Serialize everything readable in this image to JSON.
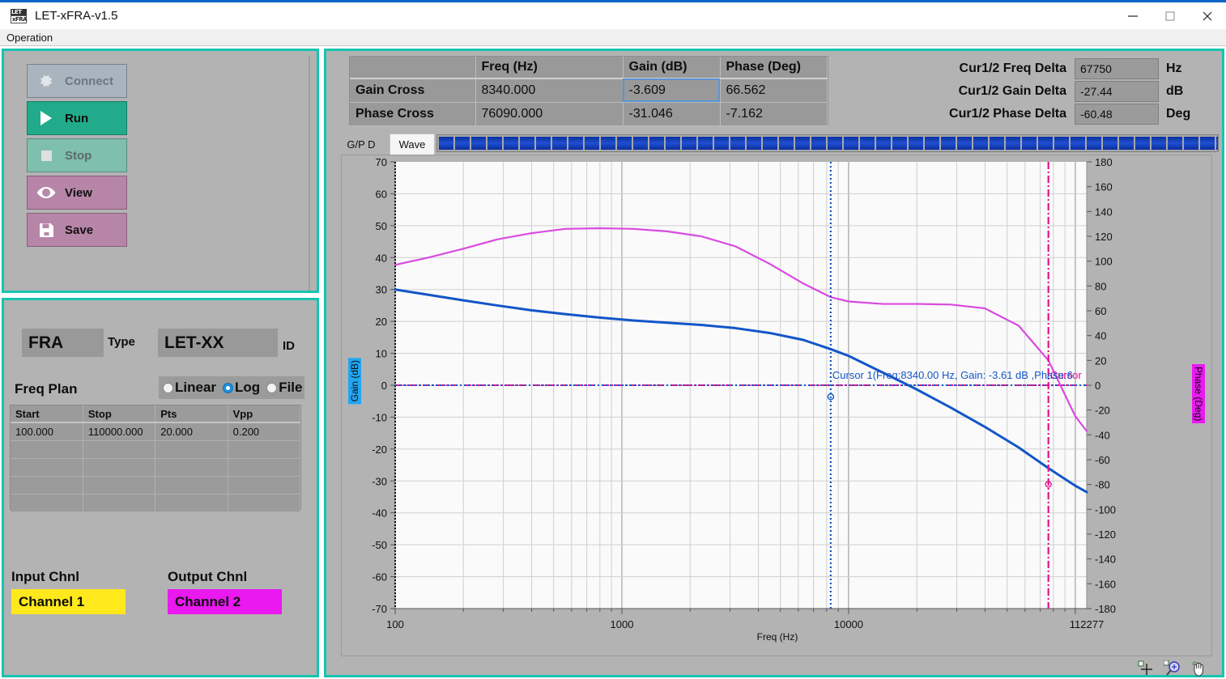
{
  "window": {
    "title": "LET-xFRA-v1.5",
    "icon": "app-icon",
    "minimize": "minimize-icon",
    "maximize": "maximize-icon",
    "close": "close-icon"
  },
  "menubar": {
    "items": [
      "Operation"
    ]
  },
  "operations": {
    "buttons": [
      {
        "label": "Connect",
        "icon": "gear-icon",
        "enabled": false,
        "color": "#aab4bf"
      },
      {
        "label": "Run",
        "icon": "play-icon",
        "enabled": true,
        "color": "#21ab8b"
      },
      {
        "label": "Stop",
        "icon": "stop-icon",
        "enabled": false,
        "color": "#7fbfae"
      },
      {
        "label": "View",
        "icon": "eye-icon",
        "enabled": true,
        "color": "#b785a8"
      },
      {
        "label": "Save",
        "icon": "save-icon",
        "enabled": true,
        "color": "#b785a8"
      }
    ]
  },
  "config": {
    "type_value": "FRA",
    "type_label": "Type",
    "id_value": "LET-XX",
    "id_label": "ID",
    "freq_plan_label": "Freq Plan",
    "sweep_modes": [
      {
        "label": "Linear",
        "selected": false
      },
      {
        "label": "Log",
        "selected": true
      },
      {
        "label": "File",
        "selected": false
      }
    ],
    "freq_table": {
      "columns": [
        "Start",
        "Stop",
        "Pts",
        "Vpp"
      ],
      "rows": [
        [
          "100.000",
          "110000.000",
          "20.000",
          "0.200"
        ],
        [
          "",
          "",
          "",
          ""
        ],
        [
          "",
          "",
          "",
          ""
        ],
        [
          "",
          "",
          "",
          ""
        ],
        [
          "",
          "",
          "",
          ""
        ]
      ]
    },
    "input_chnl_label": "Input Chnl",
    "input_chnl_value": "Channel 1",
    "input_chnl_color": "#ffe81c",
    "output_chnl_label": "Output Chnl",
    "output_chnl_value": "Channel 2",
    "output_chnl_color": "#e919ef"
  },
  "results": {
    "columns": [
      "",
      "Freq (Hz)",
      "Gain (dB)",
      "Phase (Deg)"
    ],
    "rows": [
      {
        "name": "Gain Cross",
        "freq": "8340.000",
        "gain": "-3.609",
        "phase": "66.562",
        "gain_selected": true
      },
      {
        "name": "Phase Cross",
        "freq": "76090.000",
        "gain": "-31.046",
        "phase": "-7.162",
        "gain_selected": false
      }
    ]
  },
  "cursor_deltas": [
    {
      "label": "Cur1/2 Freq Delta",
      "value": "67750",
      "unit": "Hz"
    },
    {
      "label": "Cur1/2 Gain Delta",
      "value": "-27.44",
      "unit": "dB"
    },
    {
      "label": "Cur1/2 Phase Delta",
      "value": "-60.48",
      "unit": "Deg"
    }
  ],
  "tabs": [
    {
      "label": "G/P D",
      "active": true
    },
    {
      "label": "Wave",
      "active": false
    }
  ],
  "progress": {
    "percent": 100,
    "segments": 49
  },
  "chart_tools": [
    "crosshair-icon",
    "zoom-icon",
    "pan-icon"
  ],
  "chart_data": {
    "type": "line",
    "title": "",
    "xlabel": "Freq (Hz)",
    "ylabel": "Gain (dB)",
    "y2label": "Phase (Deg)",
    "xscale": "log",
    "xlim": [
      100,
      112277
    ],
    "xticks": [
      100,
      1000,
      10000,
      112277
    ],
    "xticklabels": [
      "100",
      "1000",
      "10000",
      "112277"
    ],
    "ylim": [
      -70,
      70
    ],
    "yticks": [
      70,
      60,
      50,
      40,
      30,
      20,
      10,
      0,
      -10,
      -20,
      -30,
      -40,
      -50,
      -60,
      -70
    ],
    "y2lim": [
      -180,
      180
    ],
    "y2ticks": [
      180,
      160,
      140,
      120,
      100,
      80,
      60,
      40,
      20,
      0,
      -20,
      -40,
      -60,
      -80,
      -100,
      -120,
      -140,
      -160,
      -180
    ],
    "grid": true,
    "legend": "none",
    "series": [
      {
        "name": "Gain",
        "axis": "left",
        "color": "#1256c8",
        "x": [
          100,
          141,
          200,
          282,
          398,
          562,
          794,
          1122,
          1585,
          2239,
          3162,
          4467,
          6310,
          8340,
          10000,
          14125,
          19953,
          28184,
          39811,
          56234,
          76090,
          100000,
          112277
        ],
        "values": [
          30.0,
          28.3,
          26.6,
          25.0,
          23.5,
          22.3,
          21.2,
          20.3,
          19.6,
          18.9,
          17.9,
          16.4,
          14.2,
          11.3,
          9.2,
          4.0,
          -1.3,
          -7.0,
          -13.0,
          -19.5,
          -26.0,
          -31.5,
          -33.5
        ]
      },
      {
        "name": "Phase",
        "axis": "right",
        "color": "#d94ae0",
        "x": [
          100,
          141,
          200,
          282,
          398,
          562,
          794,
          1122,
          1585,
          2239,
          3162,
          4467,
          6310,
          8340,
          10000,
          14125,
          19953,
          28184,
          39811,
          56234,
          76090,
          100000,
          112277
        ],
        "values": [
          97.0,
          103.0,
          110.0,
          117.5,
          122.5,
          126.0,
          126.5,
          126.0,
          124.0,
          120.0,
          112.0,
          98.0,
          82.0,
          71.0,
          67.5,
          65.5,
          65.5,
          65.0,
          62.0,
          48.0,
          20.0,
          -25.0,
          -37.0
        ]
      }
    ],
    "cursors": [
      {
        "name": "Cursor 1",
        "freq": 8340.0,
        "gain": -3.61,
        "phase": 66.56,
        "color": "#1256c8",
        "style": "dotted",
        "annotation": "Cursor 1(Freq:8340.00 Hz, Gain: -3.61 dB ,Phase:6"
      },
      {
        "name": "Cursor 2",
        "freq": 76090.0,
        "gain": -31.05,
        "phase": -7.16,
        "color": "#e5128f",
        "style": "dashdot",
        "annotation": "Cursor"
      }
    ]
  }
}
